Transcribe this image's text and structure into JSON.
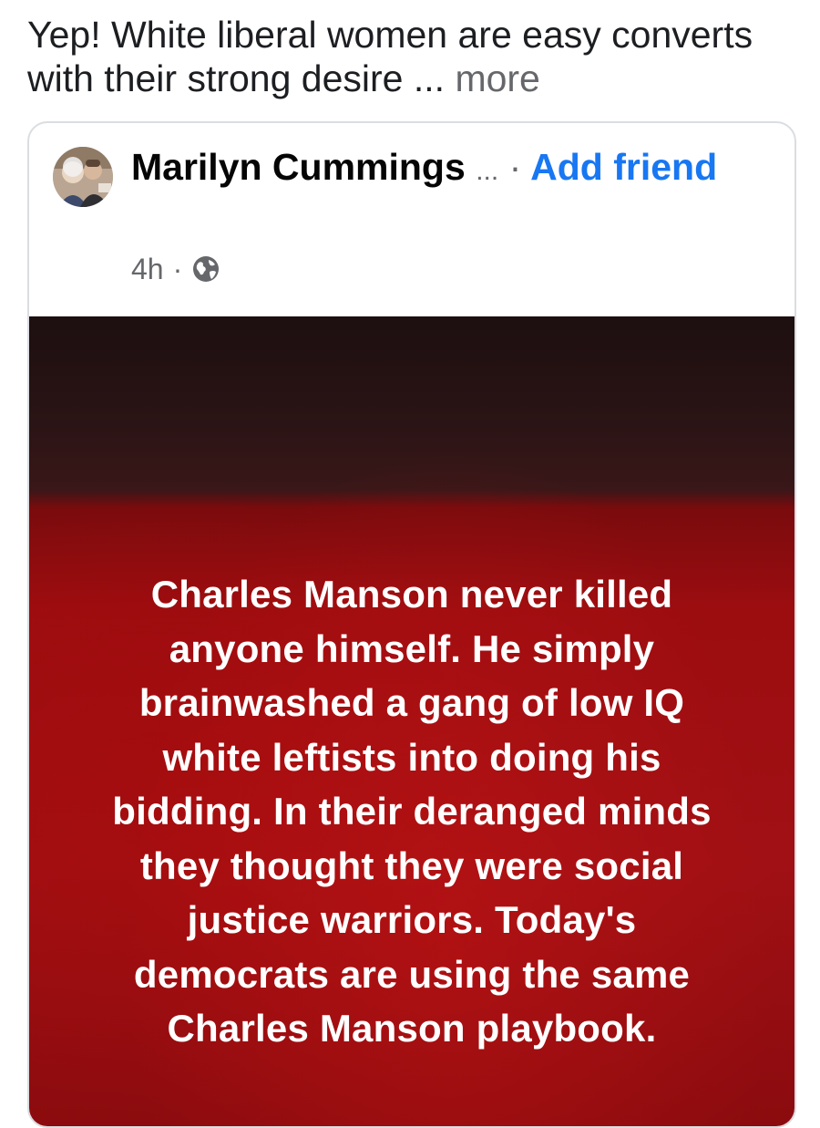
{
  "caption": {
    "text": "Yep! White liberal women are easy converts with their strong desire",
    "ellipsis": " ... ",
    "more_label": "more"
  },
  "post": {
    "author_name": "Marilyn Cummings",
    "author_truncation": "...",
    "separator": "·",
    "add_friend_label": "Add friend",
    "timestamp": "4h",
    "meta_separator": "·",
    "audience_icon": "globe-icon",
    "image_lines": [
      "Charles Manson never killed",
      "anyone himself. He simply",
      "brainwashed a gang of low IQ",
      "white leftists into doing his",
      "bidding. In their deranged minds",
      "they thought they were social",
      "justice warriors. Today's",
      "democrats are using the same",
      "Charles Manson playbook."
    ]
  },
  "colors": {
    "link": "#1877f2",
    "secondary_text": "#65676b",
    "image_red": "#a01014"
  }
}
